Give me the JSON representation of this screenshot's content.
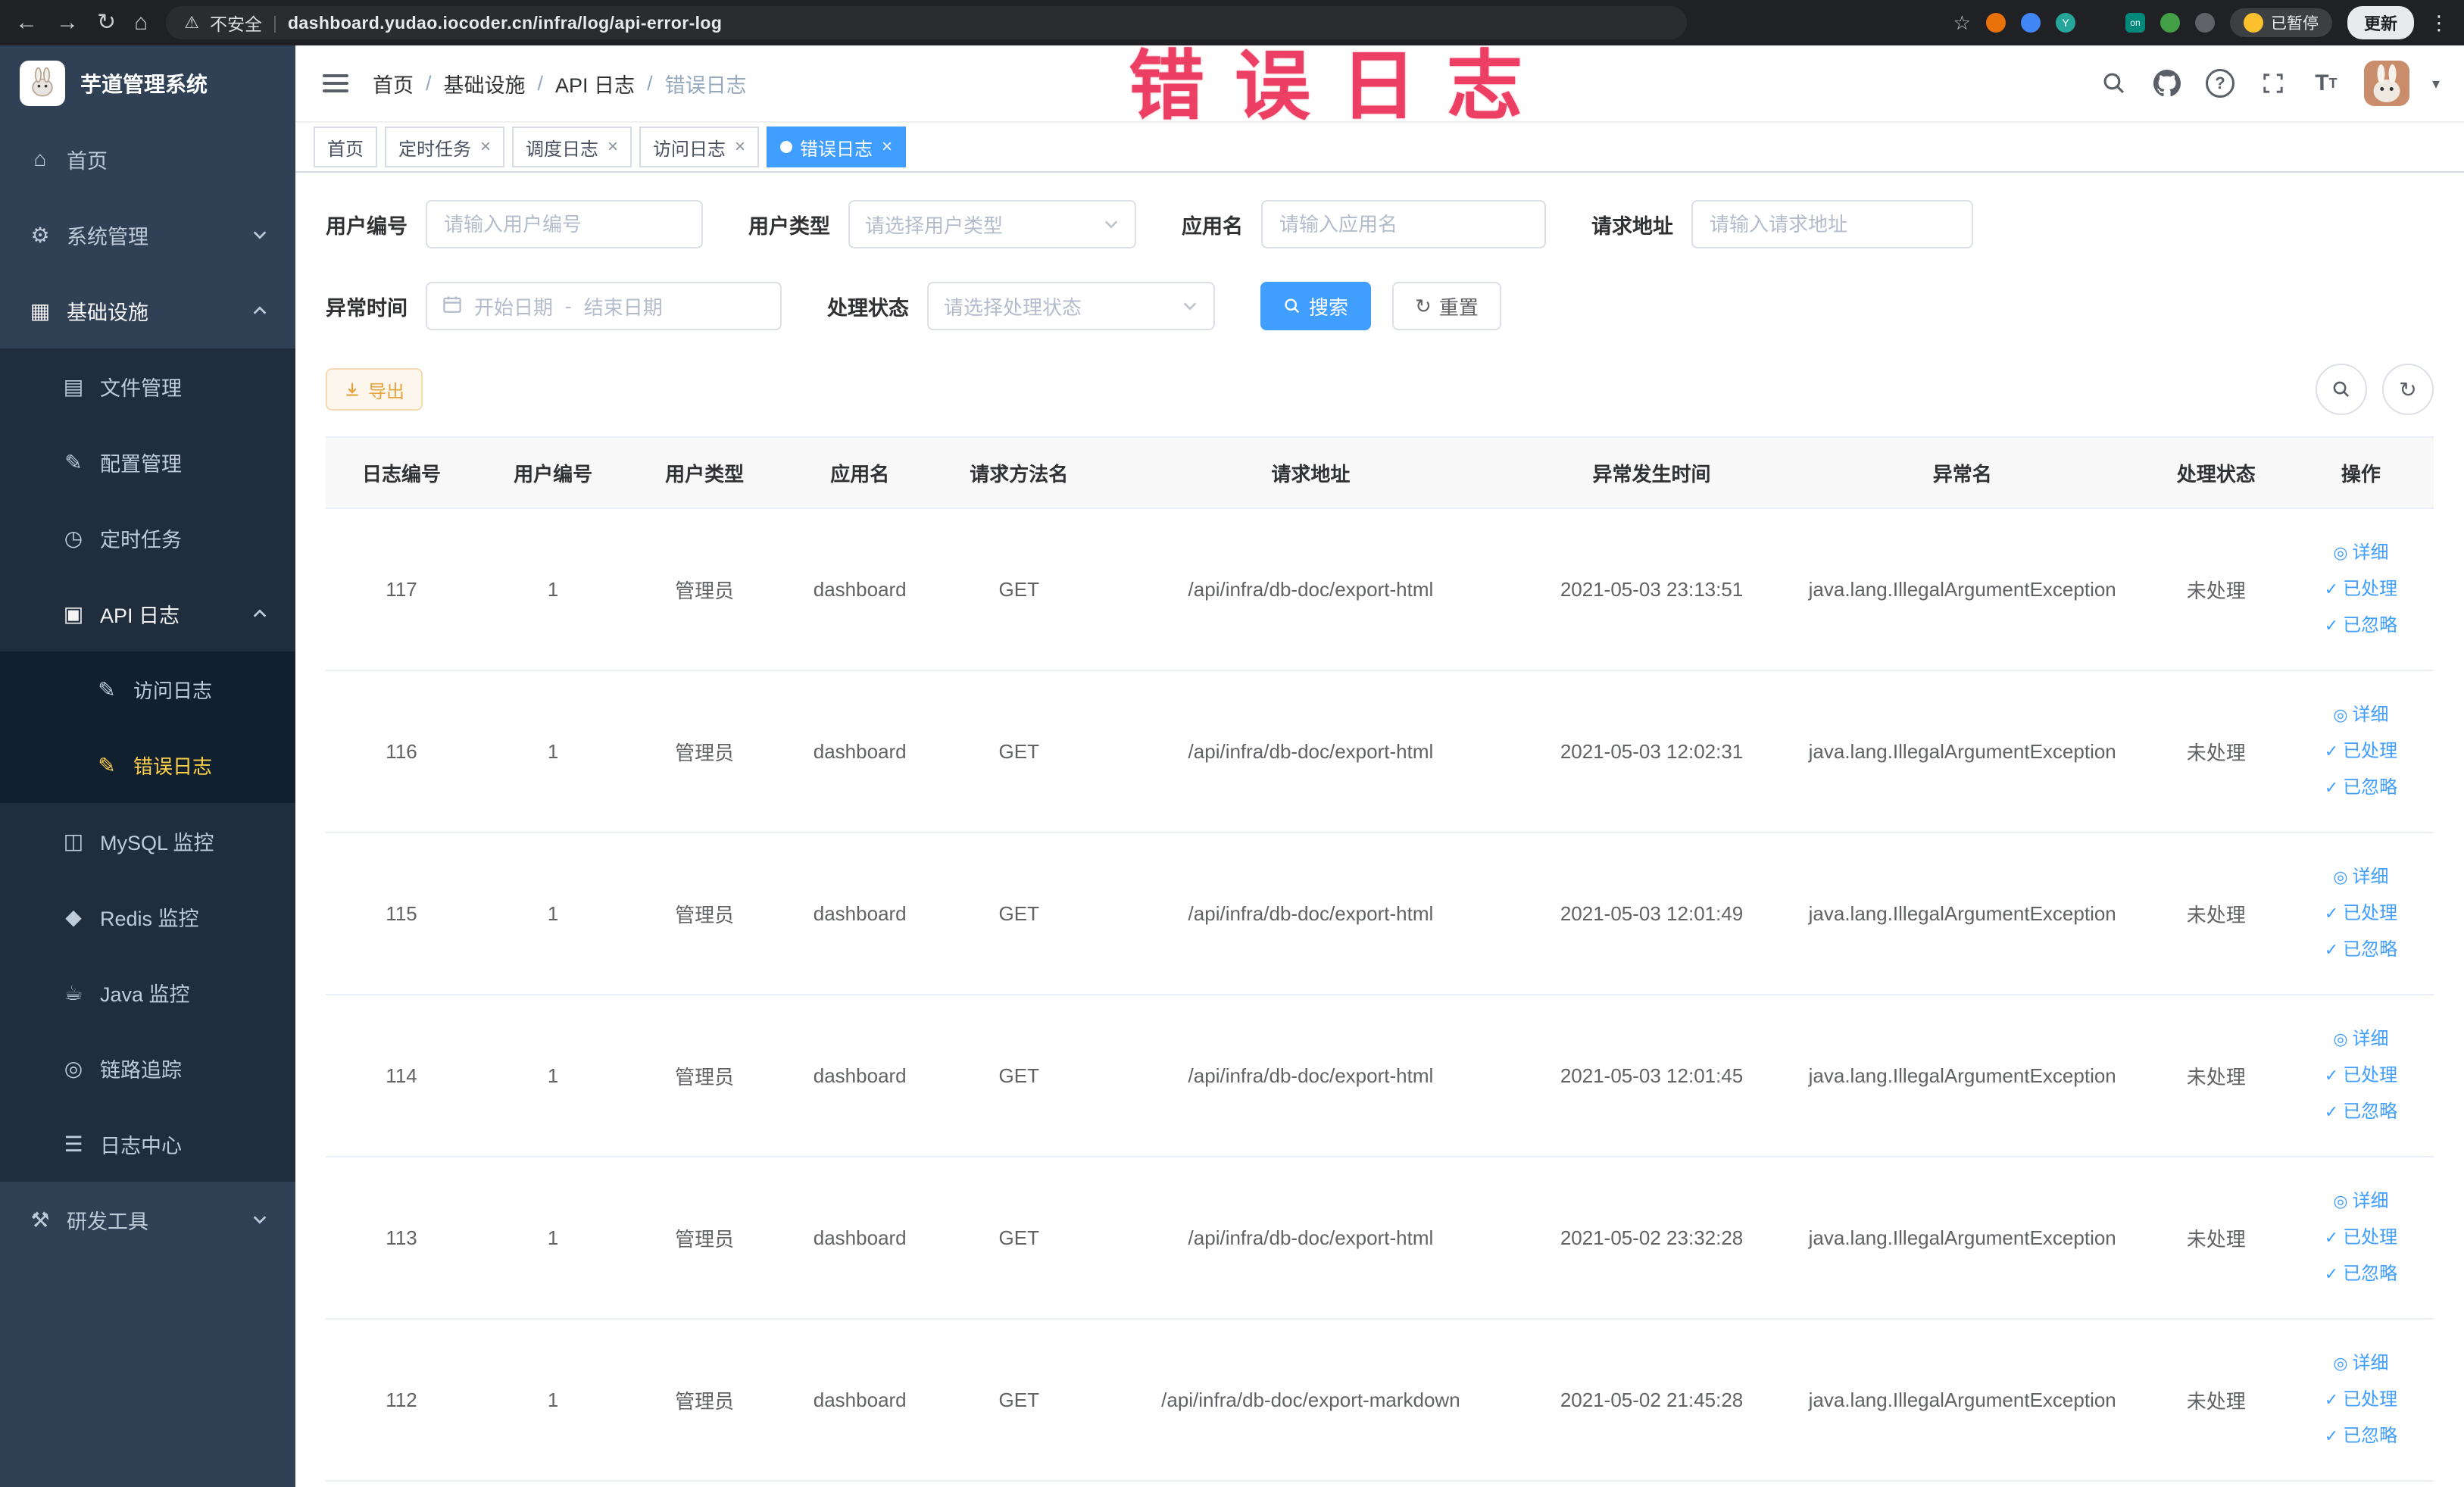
{
  "browser": {
    "security_label": "不安全",
    "url": "dashboard.yudao.iocoder.cn/infra/log/api-error-log",
    "paused_label": "已暂停",
    "update_label": "更新"
  },
  "sidebar": {
    "logo_title": "芋道管理系统",
    "items": [
      {
        "label": "首页",
        "glyph": "⌂"
      },
      {
        "label": "系统管理",
        "glyph": "⚙"
      },
      {
        "label": "基础设施",
        "glyph": "▦"
      },
      {
        "label": "文件管理",
        "glyph": "▤"
      },
      {
        "label": "配置管理",
        "glyph": "✎"
      },
      {
        "label": "定时任务",
        "glyph": "◷"
      },
      {
        "label": "API 日志",
        "glyph": "▣"
      },
      {
        "label": "访问日志",
        "glyph": "✎"
      },
      {
        "label": "错误日志",
        "glyph": "✎"
      },
      {
        "label": "MySQL 监控",
        "glyph": "◫"
      },
      {
        "label": "Redis 监控",
        "glyph": "◆"
      },
      {
        "label": "Java 监控",
        "glyph": "☕"
      },
      {
        "label": "链路追踪",
        "glyph": "◎"
      },
      {
        "label": "日志中心",
        "glyph": "☰"
      },
      {
        "label": "研发工具",
        "glyph": "⚒"
      }
    ]
  },
  "header": {
    "breadcrumb": [
      "首页",
      "基础设施",
      "API 日志",
      "错误日志"
    ],
    "watermark": "错误日志"
  },
  "tabs": [
    {
      "label": "首页"
    },
    {
      "label": "定时任务"
    },
    {
      "label": "调度日志"
    },
    {
      "label": "访问日志"
    },
    {
      "label": "错误日志"
    }
  ],
  "filters": {
    "user_id_label": "用户编号",
    "user_id_placeholder": "请输入用户编号",
    "user_type_label": "用户类型",
    "user_type_placeholder": "请选择用户类型",
    "app_name_label": "应用名",
    "app_name_placeholder": "请输入应用名",
    "request_url_label": "请求地址",
    "request_url_placeholder": "请输入请求地址",
    "exception_time_label": "异常时间",
    "start_date_placeholder": "开始日期",
    "range_separator": "-",
    "end_date_placeholder": "结束日期",
    "process_status_label": "处理状态",
    "process_status_placeholder": "请选择处理状态",
    "search_label": "搜索",
    "reset_label": "重置"
  },
  "toolbar": {
    "export_label": "导出"
  },
  "table": {
    "headers": [
      "日志编号",
      "用户编号",
      "用户类型",
      "应用名",
      "请求方法名",
      "请求地址",
      "异常发生时间",
      "异常名",
      "处理状态",
      "操作"
    ],
    "actions": {
      "detail": {
        "label": "详细",
        "glyph": "◎"
      },
      "processed": {
        "label": "已处理",
        "glyph": "✓"
      },
      "ignored": {
        "label": "已忽略",
        "glyph": "✓"
      }
    },
    "rows": [
      {
        "id": "117",
        "user_id": "1",
        "user_type": "管理员",
        "app": "dashboard",
        "method": "GET",
        "url": "/api/infra/db-doc/export-html",
        "time": "2021-05-03 23:13:51",
        "exception": "java.lang.IllegalArgumentException",
        "status": "未处理"
      },
      {
        "id": "116",
        "user_id": "1",
        "user_type": "管理员",
        "app": "dashboard",
        "method": "GET",
        "url": "/api/infra/db-doc/export-html",
        "time": "2021-05-03 12:02:31",
        "exception": "java.lang.IllegalArgumentException",
        "status": "未处理"
      },
      {
        "id": "115",
        "user_id": "1",
        "user_type": "管理员",
        "app": "dashboard",
        "method": "GET",
        "url": "/api/infra/db-doc/export-html",
        "time": "2021-05-03 12:01:49",
        "exception": "java.lang.IllegalArgumentException",
        "status": "未处理"
      },
      {
        "id": "114",
        "user_id": "1",
        "user_type": "管理员",
        "app": "dashboard",
        "method": "GET",
        "url": "/api/infra/db-doc/export-html",
        "time": "2021-05-03 12:01:45",
        "exception": "java.lang.IllegalArgumentException",
        "status": "未处理"
      },
      {
        "id": "113",
        "user_id": "1",
        "user_type": "管理员",
        "app": "dashboard",
        "method": "GET",
        "url": "/api/infra/db-doc/export-html",
        "time": "2021-05-02 23:32:28",
        "exception": "java.lang.IllegalArgumentException",
        "status": "未处理"
      },
      {
        "id": "112",
        "user_id": "1",
        "user_type": "管理员",
        "app": "dashboard",
        "method": "GET",
        "url": "/api/infra/db-doc/export-markdown",
        "time": "2021-05-02 21:45:28",
        "exception": "java.lang.IllegalArgumentException",
        "status": "未处理"
      }
    ]
  },
  "colors": {
    "primary": "#409eff",
    "sidebar_bg": "#304156",
    "sidebar_sub_bg": "#1f2d3d",
    "active_menu": "#ffd04b",
    "warning": "#e6a23c",
    "watermark": "#ec3f63"
  }
}
